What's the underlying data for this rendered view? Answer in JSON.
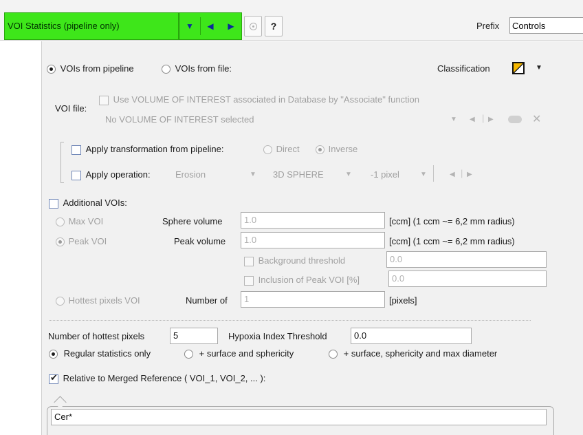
{
  "header": {
    "title": "VOI Statistics (pipeline only)",
    "prefix_label": "Prefix",
    "prefix_value": "Controls",
    "help_label": "?"
  },
  "sources": {
    "from_pipeline_label": "VOIs from pipeline",
    "from_file_label": "VOIs from file:",
    "selected": "pipeline",
    "classification_label": "Classification"
  },
  "voi_file": {
    "label": "VOI file:",
    "use_db_label": "Use VOLUME OF INTEREST associated in Database by \"Associate\" function",
    "value": "No VOLUME OF INTEREST selected"
  },
  "transform": {
    "apply_label": "Apply transformation from pipeline:",
    "direct_label": "Direct",
    "inverse_label": "Inverse",
    "selected": "Inverse"
  },
  "operation": {
    "apply_label": "Apply operation:",
    "type": "Erosion",
    "shape": "3D SPHERE",
    "size": "-1 pixel"
  },
  "additional": {
    "label": "Additional VOIs:",
    "max_voi_label": "Max VOI",
    "sphere_volume_label": "Sphere volume",
    "sphere_volume_value": "1.0",
    "sphere_unit": "[ccm]  (1 ccm ~= 6,2 mm radius)",
    "peak_voi_label": "Peak VOI",
    "peak_volume_label": "Peak volume",
    "peak_volume_value": "1.0",
    "peak_unit": "[ccm]  (1 ccm ~= 6,2 mm radius)",
    "background_label": "Background threshold",
    "background_value": "0.0",
    "inclusion_label": "Inclusion of Peak VOI [%]",
    "inclusion_value": "0.0",
    "hottest_voi_label": "Hottest pixels VOI",
    "number_of_label": "Number of",
    "number_of_value": "1",
    "pixels_unit": "[pixels]"
  },
  "stats": {
    "hottest_label": "Number of hottest pixels",
    "hottest_value": "5",
    "hypoxia_label": "Hypoxia Index Threshold",
    "hypoxia_value": "0.0",
    "regular_label": "Regular statistics only",
    "surface_label": "+ surface and sphericity",
    "surface_max_label": "+ surface, sphericity and max diameter",
    "selected": "regular"
  },
  "reference": {
    "label": "Relative to Merged Reference ( VOI_1, VOI_2, ... ):",
    "checked": true,
    "value": "Cer*"
  },
  "colors": {
    "header_green": "#3ee61a",
    "panel_bg": "#f1f1f1",
    "accent_blue": "#1f3f8f"
  }
}
